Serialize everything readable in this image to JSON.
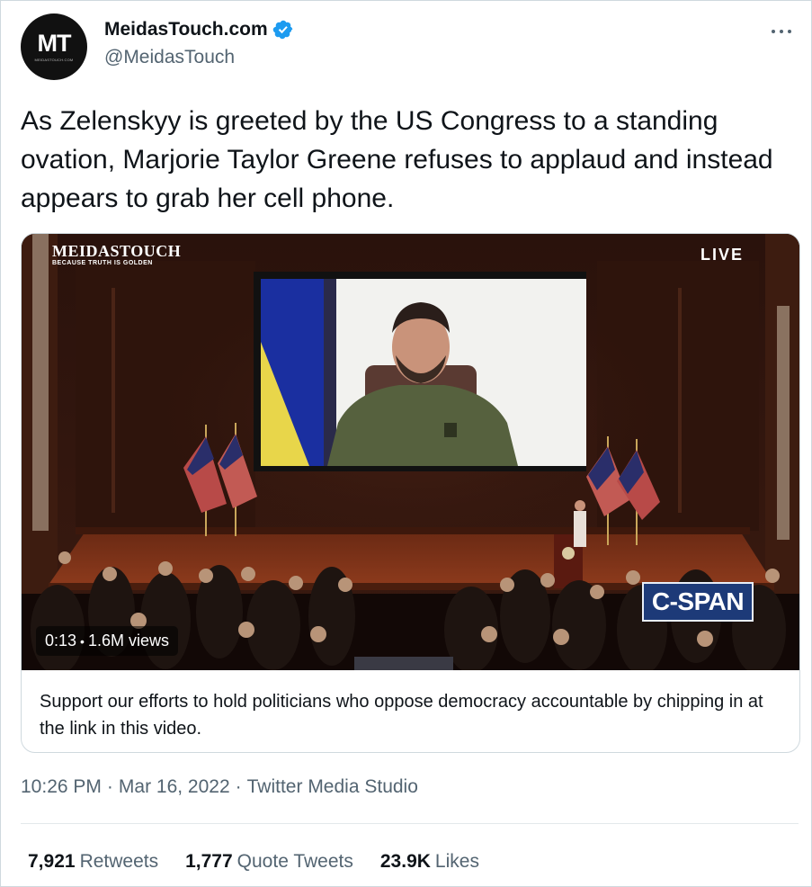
{
  "author": {
    "avatar_text": "MT",
    "avatar_subtext": "MEIDASTOUCH.COM",
    "display_name": "MeidasTouch.com",
    "handle": "@MeidasTouch",
    "verified": true,
    "verified_icon": "verified-badge-icon"
  },
  "tweet": {
    "text": "As Zelenskyy is greeted by the US Congress to a standing ovation, Marjorie Taylor Greene refuses to applaud and instead appears to grab her cell phone."
  },
  "media": {
    "brand_title": "MEIDASTOUCH",
    "brand_tagline": "BECAUSE TRUTH IS GOLDEN",
    "live_label": "LIVE",
    "network_logo": "C-SPAN",
    "duration": "0:13",
    "views": "1.6M views",
    "description": "Support our efforts to hold politicians who oppose democracy accountable by chipping in at the link in this video."
  },
  "meta": {
    "time": "10:26 PM",
    "date": "Mar 16, 2022",
    "separator": "·",
    "source": "Twitter Media Studio"
  },
  "stats": {
    "retweets_count": "7,921",
    "retweets_label": "Retweets",
    "quotes_count": "1,777",
    "quotes_label": "Quote Tweets",
    "likes_count": "23.9K",
    "likes_label": "Likes"
  },
  "colors": {
    "text_primary": "#0f1419",
    "text_secondary": "#536471",
    "verified_blue": "#1d9bf0",
    "border": "#cfd9de"
  }
}
